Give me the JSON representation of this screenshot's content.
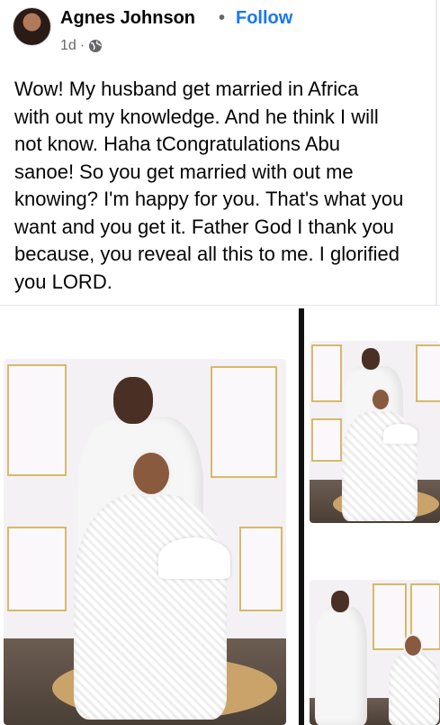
{
  "post": {
    "author": "Agnes Johnson",
    "separator": "•",
    "follow_label": "Follow",
    "time": "1d",
    "time_separator": "·",
    "privacy_icon": "globe-icon",
    "text": "Wow! My husband get married in Africa\nwith out my knowledge. And he think I will\nnot know. Haha tCongratulations Abu\nsanoe! So you get married with out me\nknowing? I'm happy for you. That's what you\nwant and you get it. Father God I thank you\nbecause, you reveal all this to me. I glorified\nyou LORD."
  },
  "photos": [
    {
      "name": "wedding-photo-main",
      "content": "couple in white attire seated / standing"
    },
    {
      "name": "wedding-photo-top-right",
      "content": "couple in white attire"
    },
    {
      "name": "wedding-photo-bottom-right",
      "content": "couple in white attire"
    }
  ],
  "colors": {
    "follow": "#1877f2",
    "text": "#050505",
    "meta": "#65676b",
    "panel_gold": "#d6b96a"
  }
}
